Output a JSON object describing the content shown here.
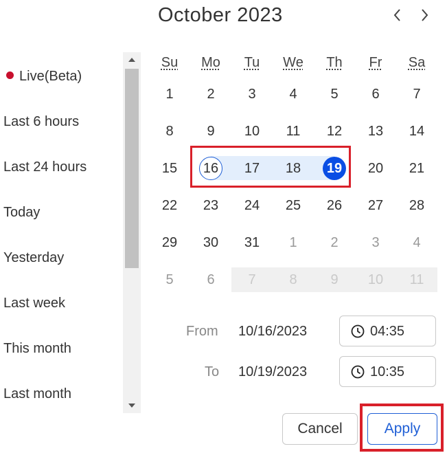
{
  "calendar": {
    "title": "October 2023",
    "weekdays": [
      "Su",
      "Mo",
      "Tu",
      "We",
      "Th",
      "Fr",
      "Sa"
    ],
    "weeks": [
      [
        "1",
        "2",
        "3",
        "4",
        "5",
        "6",
        "7"
      ],
      [
        "8",
        "9",
        "10",
        "11",
        "12",
        "13",
        "14"
      ],
      [
        "15",
        "16",
        "17",
        "18",
        "19",
        "20",
        "21"
      ],
      [
        "22",
        "23",
        "24",
        "25",
        "26",
        "27",
        "28"
      ],
      [
        "29",
        "30",
        "31",
        "1",
        "2",
        "3",
        "4"
      ],
      [
        "5",
        "6",
        "7",
        "8",
        "9",
        "10",
        "11"
      ]
    ],
    "range_start": "16",
    "range_end": "19",
    "colors": {
      "accent": "#0a4ee4",
      "range_fill": "#e3eefc",
      "highlight_box": "#d9202a",
      "live_dot": "#c8102e"
    }
  },
  "presets": [
    {
      "label": "Live(Beta)"
    },
    {
      "label": "Last 6 hours"
    },
    {
      "label": "Last 24 hours"
    },
    {
      "label": "Today"
    },
    {
      "label": "Yesterday"
    },
    {
      "label": "Last week"
    },
    {
      "label": "This month"
    },
    {
      "label": "Last month"
    }
  ],
  "from": {
    "label": "From",
    "date": "10/16/2023",
    "time": "04:35"
  },
  "to": {
    "label": "To",
    "date": "10/19/2023",
    "time": "10:35"
  },
  "buttons": {
    "cancel": "Cancel",
    "apply": "Apply"
  },
  "icons": {
    "prev": "chevron-left-icon",
    "next": "chevron-right-icon",
    "clock": "clock-icon"
  }
}
